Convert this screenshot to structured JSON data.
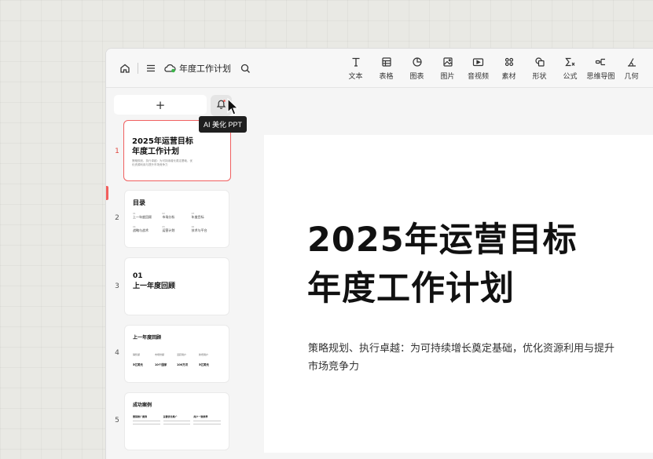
{
  "topbar": {
    "doc_title": "年度工作计划",
    "tools": [
      {
        "label": "文本",
        "icon": "text-icon"
      },
      {
        "label": "表格",
        "icon": "table-icon"
      },
      {
        "label": "图表",
        "icon": "chart-icon"
      },
      {
        "label": "图片",
        "icon": "image-icon"
      },
      {
        "label": "音视频",
        "icon": "video-icon"
      },
      {
        "label": "素材",
        "icon": "material-icon"
      },
      {
        "label": "形状",
        "icon": "shape-icon"
      },
      {
        "label": "公式",
        "icon": "formula-icon"
      },
      {
        "label": "思维导图",
        "icon": "mindmap-icon"
      },
      {
        "label": "几何",
        "icon": "geometry-icon"
      }
    ]
  },
  "sidebar": {
    "add_label": "+",
    "tooltip": "AI 美化 PPT",
    "slides": [
      {
        "num": "1",
        "title_l1": "2025年运营目标",
        "title_l2": "年度工作计划",
        "sub": "策略规划、执行卓越：为可持续增长奠定基础，优化资源利用与提升市场竞争力"
      },
      {
        "num": "2",
        "title": "目录",
        "items": [
          {
            "n": "01",
            "t": "上一年度回顾"
          },
          {
            "n": "02",
            "t": "市场分析"
          },
          {
            "n": "03",
            "t": "年度目标"
          },
          {
            "n": "04",
            "t": "战略与战术"
          },
          {
            "n": "05",
            "t": "运营计划"
          },
          {
            "n": "06",
            "t": "技术与平台"
          }
        ]
      },
      {
        "num": "3",
        "n": "01",
        "title": "上一年度回顾"
      },
      {
        "num": "4",
        "title": "上一年度回顾",
        "stats": [
          {
            "label": "销售额",
            "value": "5亿美元"
          },
          {
            "label": "市场份额",
            "value": "10个国家"
          },
          {
            "label": "活跃用户",
            "value": "100万次"
          },
          {
            "label": "新增用户",
            "value": "5亿美元"
          }
        ]
      },
      {
        "num": "5",
        "title": "成功案例",
        "cols": [
          "营销推广案例",
          "运营优化推广",
          "用户一致推荐"
        ]
      }
    ]
  },
  "main": {
    "title_l1": "2025年运营目标",
    "title_l2": "年度工作计划",
    "subtitle": "策略规划、执行卓越：为可持续增长奠定基础，优化资源利用与提升市场竞争力"
  }
}
